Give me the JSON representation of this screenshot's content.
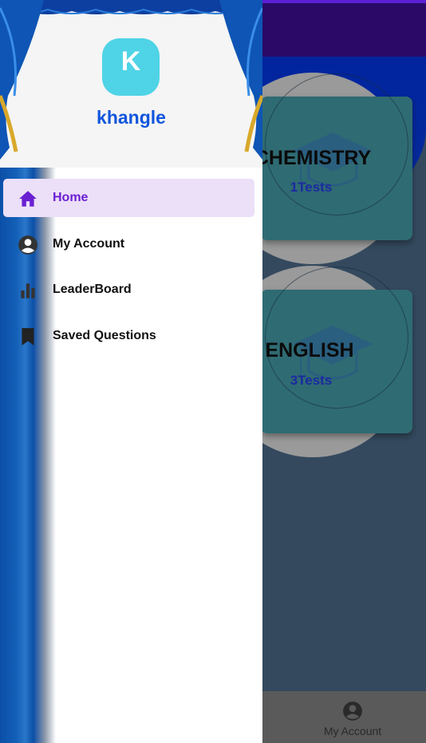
{
  "drawer": {
    "username": "khangle",
    "avatar_letter": "K",
    "menu": [
      {
        "label": "Home",
        "icon": "home-icon",
        "active": true
      },
      {
        "label": "My Account",
        "icon": "account-circle-icon",
        "active": false
      },
      {
        "label": "LeaderBoard",
        "icon": "leaderboard-icon",
        "active": false
      },
      {
        "label": "Saved Questions",
        "icon": "bookmark-icon",
        "active": false
      }
    ]
  },
  "subjects": [
    {
      "name": "CHEMISTRY",
      "count": "1Tests"
    },
    {
      "name": "ENGLISH",
      "count": "3Tests"
    }
  ],
  "bottom_nav": {
    "my_account_label": "My Account"
  },
  "colors": {
    "app_bar": "#2a0a66",
    "accent": "#6a1fd1",
    "active_item_bg": "#ecdff8",
    "username": "#1155dd",
    "avatar_bg": "#4fd3e6",
    "card_tile": "#2f6b73"
  }
}
